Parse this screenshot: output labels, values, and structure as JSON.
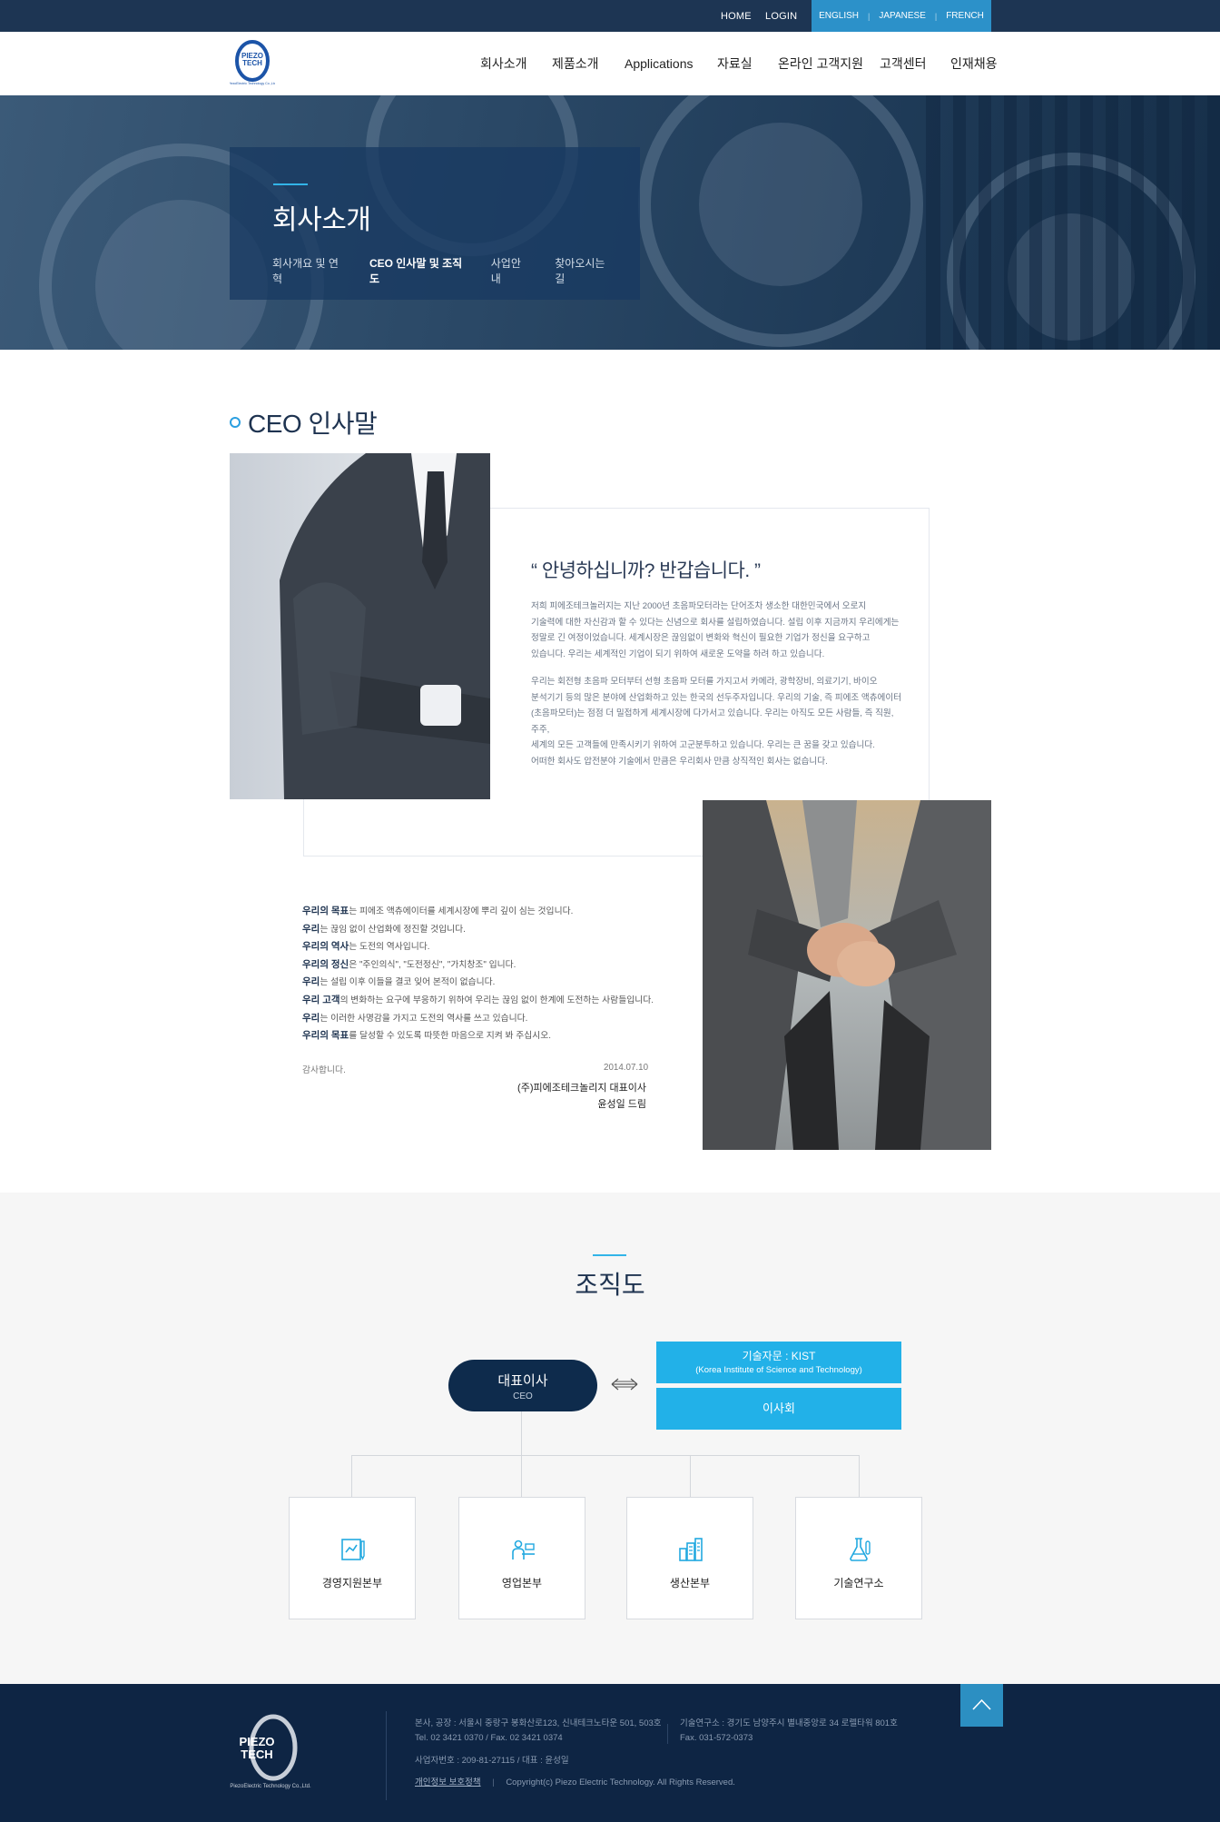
{
  "topbar": {
    "home": "HOME",
    "login": "LOGIN",
    "languages": [
      "ENGLISH",
      "JAPANESE",
      "FRENCH"
    ]
  },
  "header": {
    "logo_text_1": "PIEZO",
    "logo_text_2": "TECH",
    "logo_sub": "PiezoElectric Technology Co.,Ltd.",
    "nav": [
      "회사소개",
      "제품소개",
      "Applications",
      "자료실",
      "온라인 고객지원",
      "고객센터",
      "인재채용"
    ]
  },
  "hero": {
    "title": "회사소개",
    "tabs": [
      "회사개요 및 연혁",
      "CEO 인사말 및 조직도",
      "사업안내",
      "찾아오시는 길"
    ],
    "active_tab": 1
  },
  "ceo": {
    "section_title": "CEO 인사말",
    "greeting": "“ 안녕하십니까? 반갑습니다. ”",
    "para1": [
      "저희 피에조테크놀러지는 지난 2000년 초음파모터라는 단어조차 생소한 대한민국에서 오로지",
      "기술력에 대한 자신감과 할 수 있다는 신념으로 회사를 설립하였습니다. 설립 이후 지금까지 우리에게는",
      "정말로 긴 여정이었습니다. 세계시장은 끊임없이 변화와 혁신이 필요한 기업가 정신을 요구하고",
      "있습니다. 우리는 세계적인 기업이 되기 위하여 새로운 도약을 하려 하고 있습니다."
    ],
    "para2": [
      "우리는 회전형 초음파 모터부터 선형 초음파 모터를 가지고서 카메라, 광학장비, 의료기기, 바이오",
      "분석기기 등의 많은 분야에 산업화하고 있는 한국의 선두주자입니다. 우리의 기술, 즉 피에조 액츄에이터",
      "(초음파모터)는 점점 더 밀접하게 세계시장에 다가서고 있습니다. 우리는 아직도 모든 사람들, 즉 직원, 주주,",
      "세계의 모든 고객들에 만족시키기 위하여 고군분투하고 있습니다. 우리는 큰 꿈을 갖고 있습니다.",
      "어떠한 회사도 압전분야 기술에서 만큼은 우리회사 만큼 상직적인 회사는 없습니다."
    ],
    "goals": [
      {
        "b": "우리의 목표",
        "t": "는 피에조 액츄에이터를 세계시장에 뿌리 깊이 심는 것입니다."
      },
      {
        "b": "우리",
        "t": "는 끊임 없이 산업화에 정진할 것입니다."
      },
      {
        "b": "우리의 역사",
        "t": "는 도전의 역사입니다."
      },
      {
        "b": "우리의 정신",
        "t": "은 \"주인의식\", \"도전정신\", \"가치창조\" 입니다."
      },
      {
        "b": "우리",
        "t": "는 설립 이후 이들을 결코 잊어 본적이 없습니다."
      },
      {
        "b": "우리 고객",
        "t": "의 변화하는 요구에 부응하기 위하여 우리는 끊임 없이 한계에 도전하는 사람들입니다."
      },
      {
        "b": "우리",
        "t": "는 이러한 사명감을 가지고 도전의 역사를 쓰고 있습니다."
      },
      {
        "b": "우리의 목표",
        "t": "를 달성할 수 있도록 따뜻한 마음으로 지켜 봐 주십시오."
      }
    ],
    "thanks": "감사합니다.",
    "date": "2014.07.10",
    "sign_company": "(주)피에조테크놀리지 대표이사",
    "sign_name": "윤성일 드림"
  },
  "org": {
    "title": "조직도",
    "ceo_ko": "대표이사",
    "ceo_en": "CEO",
    "advisor_title": "기술자문 : KIST",
    "advisor_sub": "(Korea Institute of Science and Technology)",
    "board": "이사회",
    "departments": [
      {
        "label": "경영지원본부",
        "icon": "management-icon"
      },
      {
        "label": "영업본부",
        "icon": "sales-icon"
      },
      {
        "label": "생산본부",
        "icon": "factory-icon"
      },
      {
        "label": "기술연구소",
        "icon": "lab-flask-icon"
      }
    ]
  },
  "footer": {
    "logo_text_1": "PIEZO",
    "logo_text_2": "TECH",
    "logo_sub": "PiezoElectric Technology Co.,Ltd.",
    "address": "본사, 공장 : 서울시 중랑구 봉화산로123, 신내테크노타운 501, 503호",
    "tel": "Tel. 02 3421 0370  /  Fax. 02 3421 0374",
    "lab_address": "기술연구소 : 경기도 남양주시 별내중앙로 34 로렐타워 801호",
    "lab_fax": "Fax. 031-572-0373",
    "biz_no": "사업자번호 : 209-81-27115  /  대표 : 윤성일",
    "privacy": "개인정보 보호정책",
    "copyright": "Copyright(c) Piezo Electric Technology. All Rights Reserved."
  },
  "colors": {
    "navy": "#0e2544",
    "accent_blue": "#22b1e8",
    "lang_bar": "#2c91c9"
  }
}
